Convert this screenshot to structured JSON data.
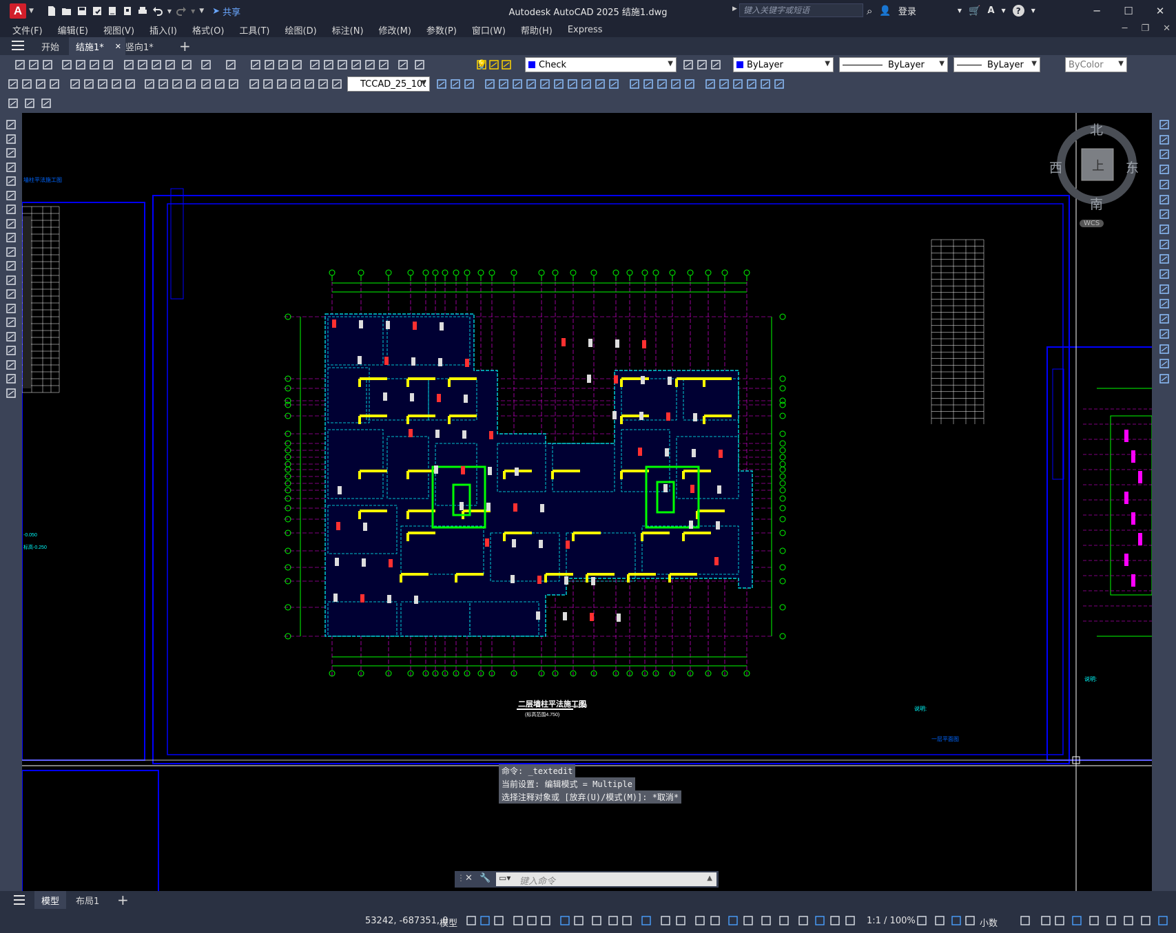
{
  "app": {
    "title": "Autodesk AutoCAD 2025    结施1.dwg",
    "share_label": "共享",
    "search_placeholder": "键入关键字或短语",
    "login_label": "登录",
    "help_label": "?"
  },
  "menu": [
    "文件(F)",
    "编辑(E)",
    "视图(V)",
    "插入(I)",
    "格式(O)",
    "工具(T)",
    "绘图(D)",
    "标注(N)",
    "修改(M)",
    "参数(P)",
    "窗口(W)",
    "帮助(H)",
    "Express"
  ],
  "tabs": [
    {
      "label": "开始",
      "active": false
    },
    {
      "label": "结施1*",
      "active": true
    },
    {
      "label": "竖向1*",
      "active": false
    }
  ],
  "toolbar": {
    "layer_name": "Check",
    "color": "ByLayer",
    "linetype": "ByLayer",
    "lineweight": "ByLayer",
    "plotstyle": "ByColor",
    "dimstyle": "TCCAD_25_100"
  },
  "viewcube": {
    "north": "北",
    "south": "南",
    "east": "东",
    "west": "西",
    "face": "上",
    "wcs": "WCS"
  },
  "drawing": {
    "plan_title": "二层墙柱平法施工图",
    "scale": "1:100",
    "plan_subtitle": "(标高范围4.750)",
    "notes_heading": "说明:",
    "right_notes_heading": "说明:",
    "left_title": "墙柱平法施工图",
    "right_caption": "一层平面图",
    "left_elev": "标高-0.250",
    "left_elev2": "-0.050"
  },
  "command": {
    "history": [
      "命令: _textedit",
      "当前设置: 编辑模式 = Multiple",
      "选择注释对象或 [放弃(U)/模式(M)]: *取消*"
    ],
    "placeholder": "键入命令"
  },
  "layout_tabs": [
    {
      "label": "模型",
      "active": true
    },
    {
      "label": "布局1",
      "active": false
    }
  ],
  "status": {
    "coords": "53242, -687351, 0",
    "model_label": "模型",
    "scale": "1:1 / 100%",
    "units": "小数"
  },
  "colors": {
    "titlebar": "#1f2433",
    "toolbar": "#3b4357",
    "accent": "#d21f2b",
    "canvas": "#000000"
  }
}
